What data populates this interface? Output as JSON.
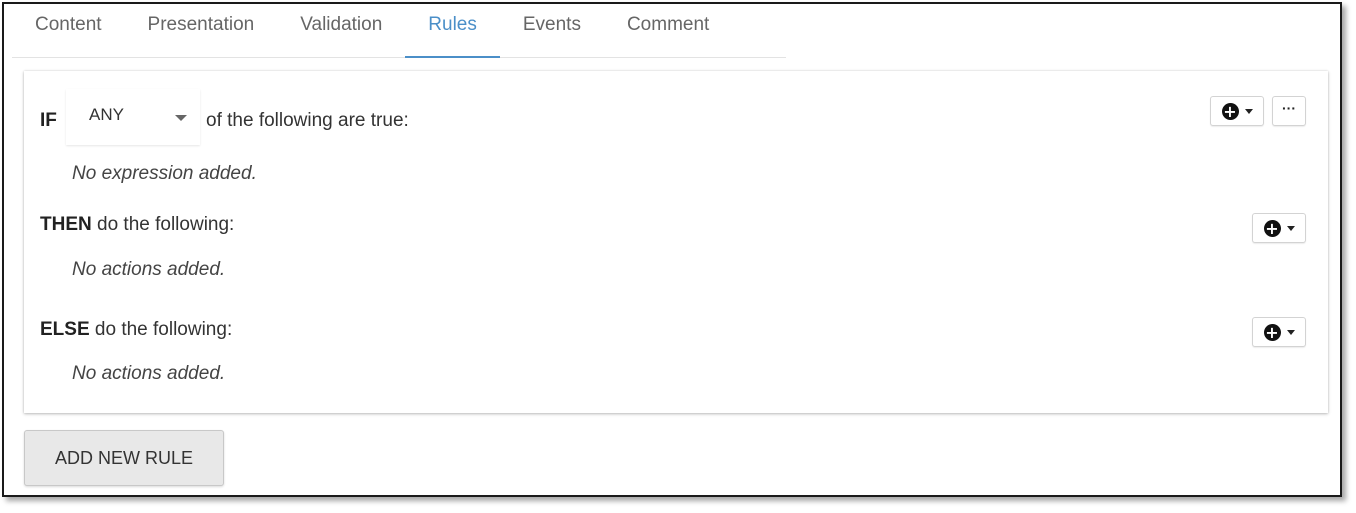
{
  "tabs": [
    {
      "label": "Content",
      "active": false
    },
    {
      "label": "Presentation",
      "active": false
    },
    {
      "label": "Validation",
      "active": false
    },
    {
      "label": "Rules",
      "active": true
    },
    {
      "label": "Events",
      "active": false
    },
    {
      "label": "Comment",
      "active": false
    }
  ],
  "rule": {
    "if_keyword": "IF",
    "match_select": {
      "value": "ANY"
    },
    "if_suffix": "of the following are true:",
    "if_empty": "No expression added.",
    "then_keyword": "THEN",
    "then_suffix": "do the following:",
    "then_empty": "No actions added.",
    "else_keyword": "ELSE",
    "else_suffix": "do the following:",
    "else_empty": "No actions added.",
    "more_label": "···",
    "plus_glyph": "+"
  },
  "add_rule_label": "ADD NEW RULE",
  "icons": {
    "add": "plus-circle-icon",
    "dropdown": "caret-down-icon",
    "more": "ellipsis-icon"
  },
  "colors": {
    "accent": "#4b8fc8",
    "tab_text": "#666666",
    "button_bg": "#e8e8e8"
  }
}
